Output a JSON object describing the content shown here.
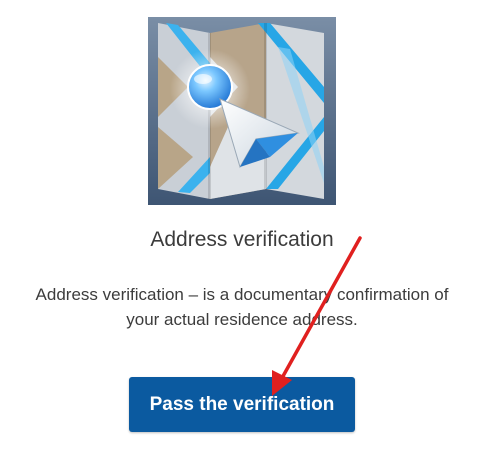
{
  "verification": {
    "icon": "map-navigation-icon",
    "title": "Address verification",
    "description_line1": "Address verification – is a documentary confirmation of",
    "description_line2": "your actual residence address.",
    "button_label": "Pass the verification"
  },
  "colors": {
    "button_bg": "#0b5aa0",
    "button_text": "#ffffff",
    "annotation_arrow": "#e0201f"
  }
}
